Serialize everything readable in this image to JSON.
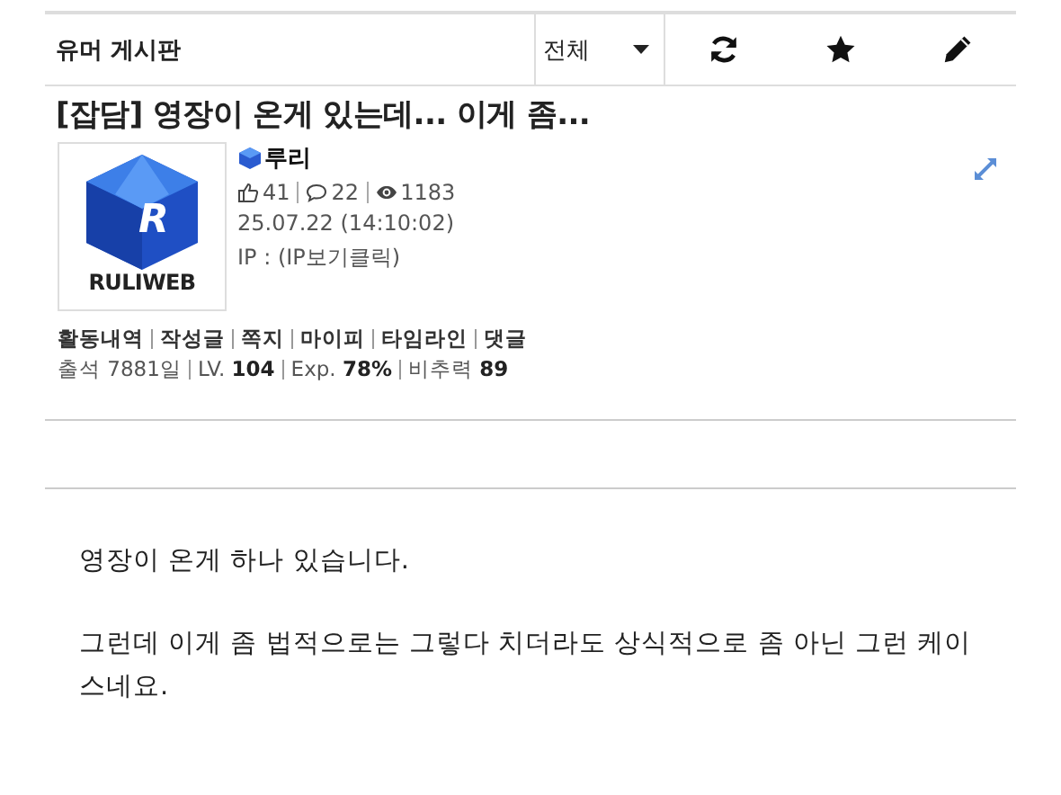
{
  "board": {
    "title": "유머 게시판",
    "filter": {
      "value": "전체"
    }
  },
  "post": {
    "title": "[잡담] 영장이 온게 있는데... 이게 좀...",
    "avatar": {
      "logo_letter": "R",
      "logo_text": "RULIWEB"
    },
    "author": "루리",
    "stats": [
      {
        "kind": "likes",
        "value": "41"
      },
      {
        "kind": "comments",
        "value": "22"
      },
      {
        "kind": "views",
        "value": "1183"
      }
    ],
    "date": "25.07.22 (14:10:02)",
    "ip": "IP : (IP보기클릭)",
    "links": [
      "활동내역",
      "작성글",
      "쪽지",
      "마이피",
      "타임라인",
      "댓글"
    ],
    "profile": [
      "출석 7881일",
      "LV. **104**",
      "Exp. **78%**",
      "비추력 **89**"
    ],
    "body": [
      "영장이 온게 하나 있습니다.",
      "그런데 이게 좀 법적으로는 그렇다 치더라도 상식적으로 좀 아닌 그런 케이스네요."
    ]
  }
}
